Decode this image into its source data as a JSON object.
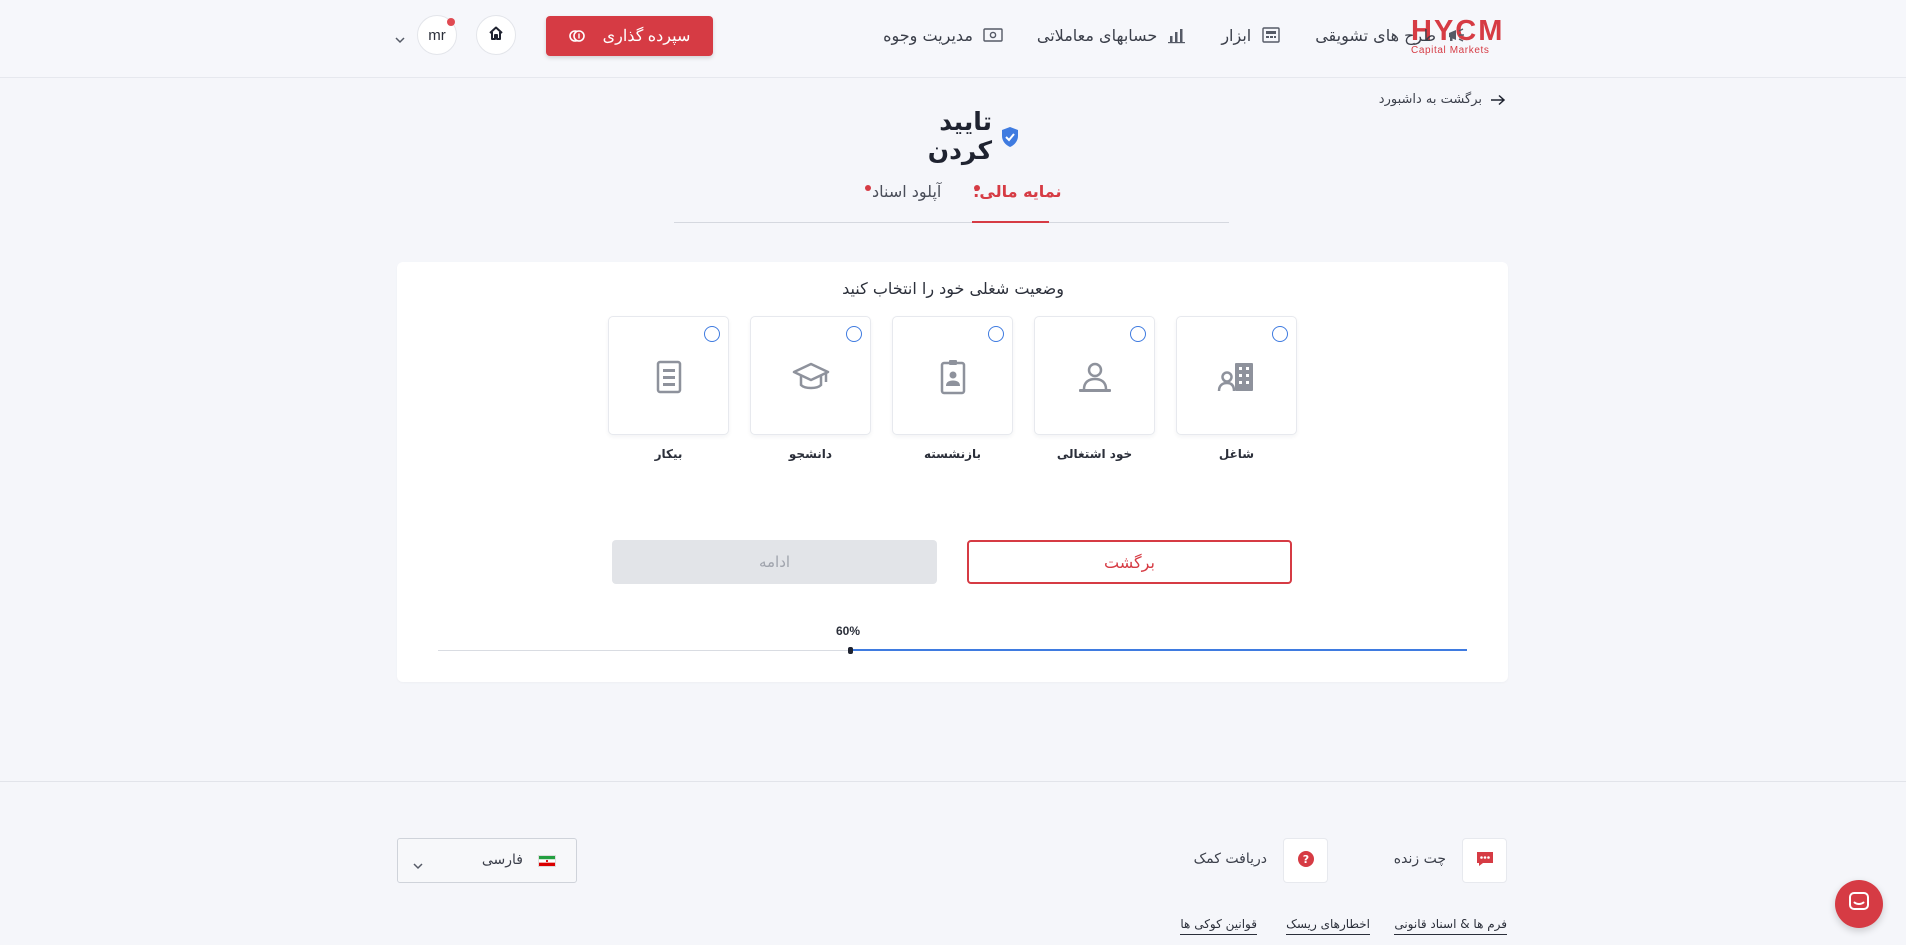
{
  "brand": {
    "name": "HYCM",
    "tagline": "Capital Markets",
    "accent": "#d63b44"
  },
  "nav": [
    {
      "label": "مدیریت وجوه",
      "icon": "money-icon"
    },
    {
      "label": "حسابهای معاملاتی",
      "icon": "bar-chart-icon"
    },
    {
      "label": "ابزار",
      "icon": "calculator-icon"
    },
    {
      "label": "طرح های تشویقی",
      "icon": "megaphone-icon"
    }
  ],
  "header": {
    "deposit_label": "سپرده گذاری",
    "avatar_initials": "mr"
  },
  "back_link": "برگشت به داشبورد",
  "page_title": "تایید کردن",
  "tabs": [
    {
      "label": "نمایه مالی:",
      "active": true
    },
    {
      "label": "آپلود اسناد",
      "active": false
    }
  ],
  "question": "وضعیت شغلی خود را انتخاب کنید",
  "options": [
    {
      "label": "شاغل",
      "icon": "office-building-user-icon"
    },
    {
      "label": "خود اشتغالی",
      "icon": "user-at-desk-icon"
    },
    {
      "label": "بازنشسته",
      "icon": "id-badge-icon"
    },
    {
      "label": "دانشجو",
      "icon": "graduation-cap-icon"
    },
    {
      "label": "بیکار",
      "icon": "document-icon"
    }
  ],
  "buttons": {
    "back": "برگشت",
    "continue": "ادامه"
  },
  "progress": {
    "percent": 60,
    "label": "60%",
    "color": "#3f7be0"
  },
  "footer": {
    "live_chat": "چت زنده",
    "get_help": "دریافت کمک",
    "language": "فارسی",
    "links": [
      "فرم ها & اسناد قانونی",
      "اخطارهای ریسک",
      "قوانین کوکی ها"
    ]
  }
}
